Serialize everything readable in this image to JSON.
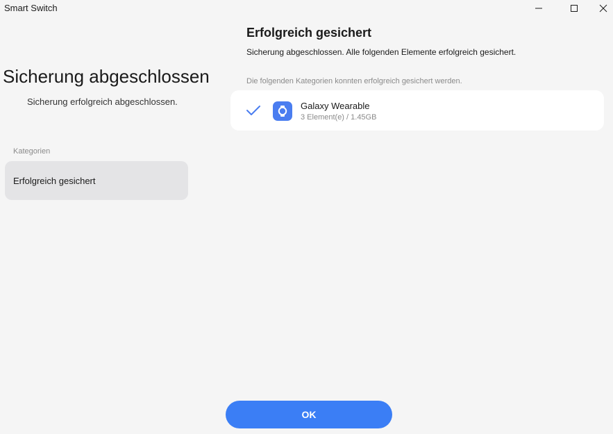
{
  "window": {
    "title": "Smart Switch"
  },
  "left": {
    "title": "Sicherung abgeschlossen",
    "subtitle": "Sicherung erfolgreich abgeschlossen.",
    "categories_label": "Kategorien",
    "categories": [
      {
        "label": "Erfolgreich gesichert",
        "selected": true
      }
    ]
  },
  "right": {
    "heading": "Erfolgreich gesichert",
    "description": "Sicherung abgeschlossen. Alle folgenden Elemente erfolgreich gesichert.",
    "note": "Die folgenden Kategorien konnten erfolgreich gesichert werden.",
    "items": [
      {
        "name": "Galaxy Wearable",
        "meta": "3 Element(e) / 1.45GB",
        "icon": "galaxy-wearable-icon",
        "status_icon": "check-icon"
      }
    ]
  },
  "footer": {
    "ok_label": "OK"
  },
  "colors": {
    "accent": "#3b7ef5",
    "app_icon": "#4a7df0",
    "check": "#4a7df0",
    "selected_bg": "#e4e4e6",
    "background": "#f5f5f5"
  }
}
